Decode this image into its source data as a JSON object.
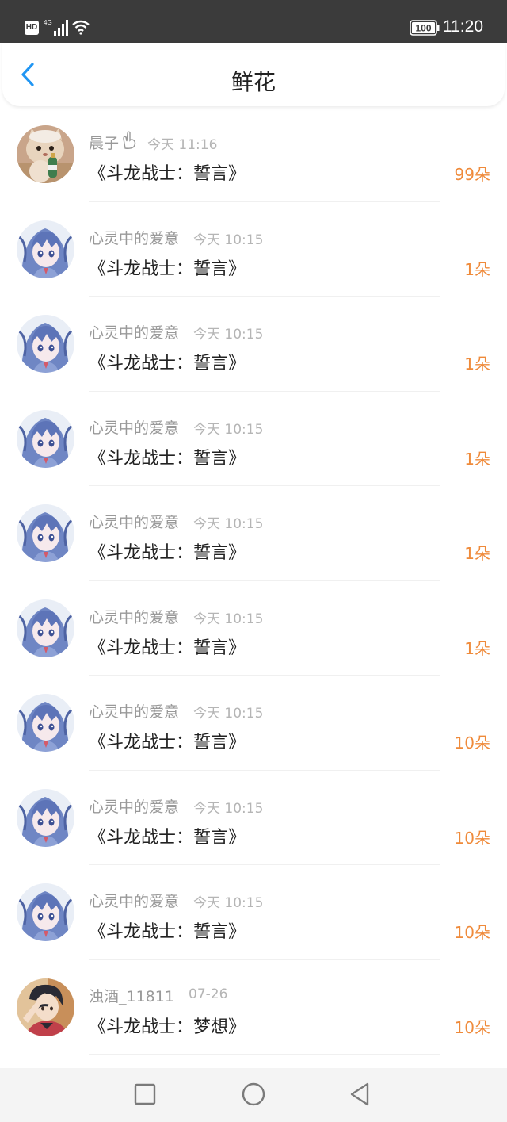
{
  "status_bar": {
    "hd": "HD",
    "network": "4G",
    "battery": "100",
    "time": "11:20"
  },
  "header": {
    "title": "鲜花"
  },
  "colors": {
    "accent_blue": "#2196f3",
    "count_orange": "#ef8a3a"
  },
  "records": [
    {
      "user": "晨子",
      "time": "今天 11:16",
      "book": "《斗龙战士：誓言》",
      "count": "99朵",
      "avatar": "cat-avatar"
    },
    {
      "user": "心灵中的爱意",
      "time": "今天 10:15",
      "book": "《斗龙战士：誓言》",
      "count": "1朵",
      "avatar": "anime-girl-avatar"
    },
    {
      "user": "心灵中的爱意",
      "time": "今天 10:15",
      "book": "《斗龙战士：誓言》",
      "count": "1朵",
      "avatar": "anime-girl-avatar"
    },
    {
      "user": "心灵中的爱意",
      "time": "今天 10:15",
      "book": "《斗龙战士：誓言》",
      "count": "1朵",
      "avatar": "anime-girl-avatar"
    },
    {
      "user": "心灵中的爱意",
      "time": "今天 10:15",
      "book": "《斗龙战士：誓言》",
      "count": "1朵",
      "avatar": "anime-girl-avatar"
    },
    {
      "user": "心灵中的爱意",
      "time": "今天 10:15",
      "book": "《斗龙战士：誓言》",
      "count": "1朵",
      "avatar": "anime-girl-avatar"
    },
    {
      "user": "心灵中的爱意",
      "time": "今天 10:15",
      "book": "《斗龙战士：誓言》",
      "count": "10朵",
      "avatar": "anime-girl-avatar"
    },
    {
      "user": "心灵中的爱意",
      "time": "今天 10:15",
      "book": "《斗龙战士：誓言》",
      "count": "10朵",
      "avatar": "anime-girl-avatar"
    },
    {
      "user": "心灵中的爱意",
      "time": "今天 10:15",
      "book": "《斗龙战士：誓言》",
      "count": "10朵",
      "avatar": "anime-girl-avatar"
    },
    {
      "user": "浊酒_11811",
      "time": "07-26",
      "book": "《斗龙战士：梦想》",
      "count": "10朵",
      "avatar": "anime-boy-avatar"
    }
  ],
  "nav": {
    "recent": "recent-apps-icon",
    "home": "home-icon",
    "back": "back-triangle-icon"
  }
}
